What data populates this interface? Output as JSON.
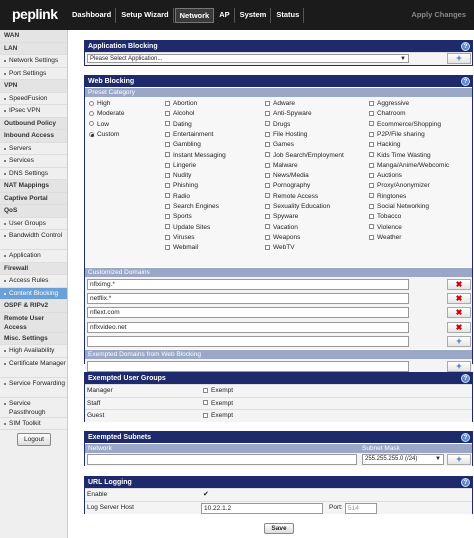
{
  "brand": {
    "logo_text": "peplink"
  },
  "nav": {
    "tabs": [
      "Dashboard",
      "Setup Wizard",
      "Network",
      "AP",
      "System",
      "Status"
    ],
    "active": "Network",
    "apply_label": "Apply Changes"
  },
  "sidebar": {
    "items": [
      {
        "label": "WAN",
        "type": "head"
      },
      {
        "label": "LAN",
        "type": "head"
      },
      {
        "label": "Network Settings",
        "type": "sub"
      },
      {
        "label": "Port Settings",
        "type": "sub"
      },
      {
        "label": "VPN",
        "type": "head"
      },
      {
        "label": "SpeedFusion",
        "type": "sub"
      },
      {
        "label": "IPsec VPN",
        "type": "sub"
      },
      {
        "label": "Outbound Policy",
        "type": "head"
      },
      {
        "label": "Inbound Access",
        "type": "head"
      },
      {
        "label": "Servers",
        "type": "sub"
      },
      {
        "label": "Services",
        "type": "sub"
      },
      {
        "label": "DNS Settings",
        "type": "sub"
      },
      {
        "label": "NAT Mappings",
        "type": "head"
      },
      {
        "label": "Captive Portal",
        "type": "head"
      },
      {
        "label": "QoS",
        "type": "head"
      },
      {
        "label": "User Groups",
        "type": "sub"
      },
      {
        "label": "Bandwidth Control",
        "type": "sub2"
      },
      {
        "label": "Application",
        "type": "sub"
      },
      {
        "label": "Firewall",
        "type": "head"
      },
      {
        "label": "Access Rules",
        "type": "sub"
      },
      {
        "label": "Content Blocking",
        "type": "active"
      },
      {
        "label": "OSPF & RIPv2",
        "type": "head"
      },
      {
        "label": "Remote User Access",
        "type": "head2"
      },
      {
        "label": "Misc. Settings",
        "type": "head"
      },
      {
        "label": "High Availability",
        "type": "sub"
      },
      {
        "label": "Certificate Manager",
        "type": "sub2"
      },
      {
        "label": "Service Forwarding",
        "type": "sub2"
      },
      {
        "label": "Service Passthrough",
        "type": "sub2"
      },
      {
        "label": "SIM Toolkit",
        "type": "sub"
      }
    ],
    "logout_label": "Logout"
  },
  "app_blocking": {
    "title": "Application Blocking",
    "select_value": "Please Select Application..."
  },
  "web_blocking": {
    "title": "Web Blocking",
    "preset_label": "Preset Category",
    "presets": [
      "High",
      "Moderate",
      "Low",
      "Custom"
    ],
    "preset_selected": "Custom",
    "categories": [
      [
        "Abortion",
        "Adware",
        "Aggressive"
      ],
      [
        "Alcohol",
        "Anti-Spyware",
        "Chatroom"
      ],
      [
        "Dating",
        "Drugs",
        "Ecommerce/Shopping"
      ],
      [
        "Entertainment",
        "File Hosting",
        "P2P/File sharing"
      ],
      [
        "Gambling",
        "Games",
        "Hacking"
      ],
      [
        "Instant Messaging",
        "Job Search/Employment",
        "Kids Time Wasting"
      ],
      [
        "Lingerie",
        "Malware",
        "Manga/Anime/Webcomic"
      ],
      [
        "Nudity",
        "News/Media",
        "Auctions"
      ],
      [
        "Phishing",
        "Pornography",
        "Proxy/Anonymizer"
      ],
      [
        "Radio",
        "Remote Access",
        "Ringtones"
      ],
      [
        "Search Engines",
        "Sexuality Education",
        "Social Networking"
      ],
      [
        "Sports",
        "Spyware",
        "Tobacco"
      ],
      [
        "Update Sites",
        "Vacation",
        "Violence"
      ],
      [
        "Viruses",
        "Weapons",
        "Weather"
      ],
      [
        "Webmail",
        "WebTV",
        ""
      ]
    ],
    "customized_label": "Customized Domains",
    "domains": [
      "nflximg.*",
      "netflix.*",
      "nflext.com",
      "nflxvideo.net"
    ],
    "exempted_label": "Exempted Domains from Web Blocking"
  },
  "user_groups": {
    "title": "Exempted User Groups",
    "rows": [
      "Manager",
      "Staff",
      "Guest"
    ],
    "option_label": "Exempt"
  },
  "subnets": {
    "title": "Exempted Subnets",
    "col_network": "Network",
    "col_mask": "Subnet Mask",
    "mask_value": "255.255.255.0 (/24)"
  },
  "url_logging": {
    "title": "URL Logging",
    "enable_label": "Enable",
    "host_label": "Log Server Host",
    "host_value": "10.22.1.2",
    "port_label": "Port:",
    "port_placeholder": "514"
  },
  "save_label": "Save",
  "colors": {
    "header_blue": "#1e2a6b",
    "sub_header": "#9aa7c7",
    "active_sidebar": "#6aa0d6"
  }
}
